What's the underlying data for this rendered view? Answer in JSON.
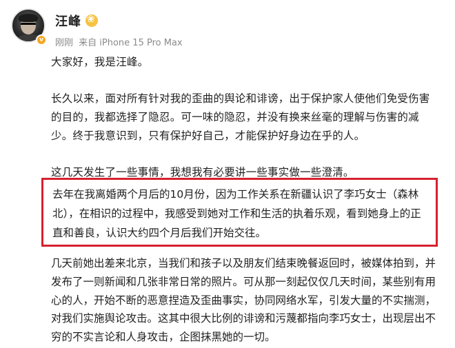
{
  "post": {
    "author_name": "汪峰",
    "time": "刚刚",
    "source": "来自 iPhone 15 Pro Max",
    "paragraphs": [
      "大家好，我是汪峰。",
      "长久以来，面对所有针对我的歪曲的舆论和诽谤，出于保护家人使他们免受伤害的目的，我都选择了隐忍。可一味的隐忍，并没有换来丝毫的理解与伤害的减少。终于我意识到，只有保护好自己，才能保护好身边在乎的人。",
      "这几天发生了一些事情，我想我有必要讲一些事实做一些澄清。",
      "去年在我离婚两个月后的10月份，因为工作关系在新疆认识了李巧女士（森林北），在相识的过程中，我感受到她对工作和生活的执着乐观，看到她身上的正直和善良，认识大约四个月后我们开始交往。",
      "几天前她出差来北京，当我们和孩子以及朋友们结束晚餐返回时，被媒体拍到，并发布了一则新闻和几张非常日常的照片。可从那一刻起仅仅几天时间，某些别有用心的人，开始不断的恶意捏造及歪曲事实，协同网络水军，引发大量的不实揣测，对我们实施舆论攻击。这其中很大比例的诽谤和污蔑都指向李巧女士，出现层出不穷的不实言论和人身攻击，企图抹黑她的一切。"
    ]
  }
}
